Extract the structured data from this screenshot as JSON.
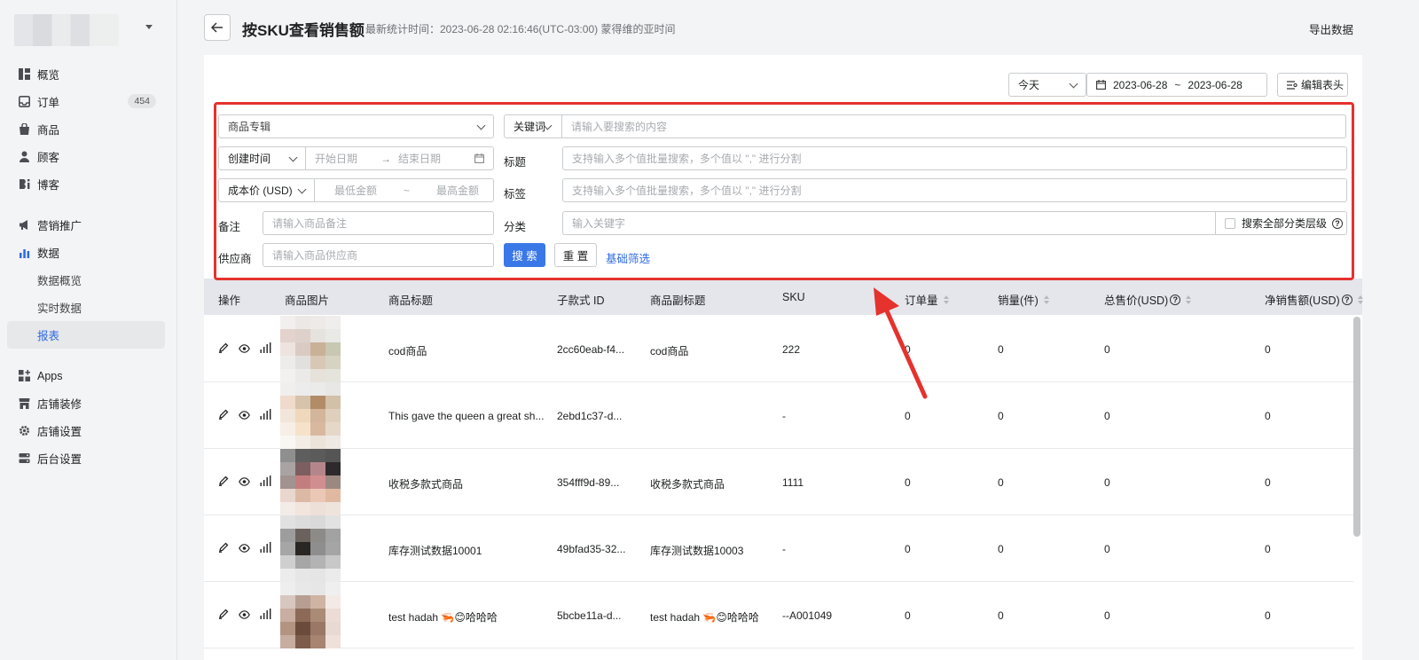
{
  "store": {
    "name": ""
  },
  "nav": [
    {
      "label": "概览",
      "icon": "overview-icon"
    },
    {
      "label": "订单",
      "icon": "orders-icon",
      "badge": "454"
    },
    {
      "label": "商品",
      "icon": "products-icon"
    },
    {
      "label": "顾客",
      "icon": "customers-icon"
    },
    {
      "label": "博客",
      "icon": "blog-icon"
    },
    {
      "label": "营销推广",
      "icon": "marketing-icon"
    },
    {
      "label": "数据",
      "icon": "analytics-icon",
      "active_color": "#2d6ae3"
    },
    {
      "label": "数据概览"
    },
    {
      "label": "实时数据"
    },
    {
      "label": "报表",
      "active": true
    },
    {
      "label": "Apps",
      "icon": "apps-icon"
    },
    {
      "label": "店铺装修",
      "icon": "storefront-icon"
    },
    {
      "label": "店铺设置",
      "icon": "settings-icon"
    },
    {
      "label": "后台设置",
      "icon": "admin-icon"
    }
  ],
  "header": {
    "title": "按SKU查看销售额",
    "stat_time": "最新统计时间：2023-06-28 02:16:46(UTC-03:00) 蒙得维的亚时间",
    "export_label": "导出数据"
  },
  "toolbar": {
    "date_preset": "今天",
    "date_start": "2023-06-28",
    "date_sep": "~",
    "date_end": "2023-06-28",
    "edit_columns_label": "编辑表头"
  },
  "filters": {
    "collection_placeholder": "商品专辑",
    "keyword_type": "关键词",
    "keyword_placeholder": "请输入要搜索的内容",
    "time_type": "创建时间",
    "start_date_placeholder": "开始日期",
    "arrow": "→",
    "end_date_placeholder": "结束日期",
    "title_label": "标题",
    "title_placeholder": "支持输入多个值批量搜索，多个值以 \",\" 进行分割",
    "price_type": "成本价 (USD)",
    "min_placeholder": "最低金额",
    "range_sep": "~",
    "max_placeholder": "最高金额",
    "tag_label": "标签",
    "tag_placeholder": "支持输入多个值批量搜索，多个值以 \",\" 进行分割",
    "note_label": "备注",
    "note_placeholder": "请输入商品备注",
    "category_label": "分类",
    "category_placeholder": "输入关键字",
    "search_all_levels": "搜索全部分类层级",
    "supplier_label": "供应商",
    "supplier_placeholder": "请输入商品供应商",
    "search_btn": "搜 索",
    "reset_btn": "重 置",
    "basic_filter": "基础筛选"
  },
  "table": {
    "columns": [
      "操作",
      "商品图片",
      "商品标题",
      "子款式 ID",
      "商品副标题",
      "SKU",
      "订单量",
      "销量(件)",
      "总售价(USD)",
      "净销售额(USD)"
    ],
    "rows": [
      {
        "title": "cod商品",
        "variant_id": "2cc60eab-f4...",
        "subtitle": "cod商品",
        "sku": "222",
        "orders": "0",
        "sales": "0",
        "total": "0",
        "net": "0",
        "thumb": [
          "#f3efee",
          "#ece8e6",
          "#eeeae8",
          "#f0eeec",
          "#e4d2cd",
          "#ded1cc",
          "#e6e2de",
          "#e9e9e6",
          "#eee3df",
          "#d9cbc3",
          "#c9b198",
          "#c8c7b2",
          "#eeeceb",
          "#e2e0de",
          "#d9c7b5",
          "#d6d3c2",
          "#f3f1f0",
          "#eceae8",
          "#e6e2da",
          "#e4e4dc"
        ]
      },
      {
        "title": "This gave the queen a great sh...",
        "variant_id": "2ebd1c37-d...",
        "subtitle": "",
        "sku": "-",
        "orders": "0",
        "sales": "0",
        "total": "0",
        "net": "0",
        "thumb": [
          "#f0efee",
          "#ececec",
          "#ebebea",
          "#e8e7e6",
          "#efdacb",
          "#d7c2ac",
          "#b28b67",
          "#d3c0a8",
          "#f2e5d9",
          "#efd8bb",
          "#d2b59a",
          "#e0cfbd",
          "#f7eee6",
          "#f6e2cb",
          "#d9b8a0",
          "#e6d8c9",
          "#faf7f3",
          "#f4ede6",
          "#ece3da",
          "#efe9e3"
        ]
      },
      {
        "title": "收税多款式商品",
        "variant_id": "354fff9d-89...",
        "subtitle": "收税多款式商品",
        "sku": "1111",
        "orders": "0",
        "sales": "0",
        "total": "0",
        "net": "0",
        "thumb": [
          "#8f8f8f",
          "#5e5e5e",
          "#5b5b5b",
          "#555555",
          "#a9a4a3",
          "#7d5e60",
          "#b4868b",
          "#2e2a2b",
          "#a29290",
          "#c47d7f",
          "#d18e91",
          "#9b8881",
          "#e9d6cc",
          "#dcb9a5",
          "#ebc7b6",
          "#e1b9a1",
          "#f3ebe6",
          "#f1e5de",
          "#ede0d8",
          "#efe4dc"
        ]
      },
      {
        "title": "库存测试数据10001",
        "variant_id": "49bfad35-32...",
        "subtitle": "库存测试数据10003",
        "sku": "-",
        "orders": "0",
        "sales": "0",
        "total": "0",
        "net": "0",
        "thumb": [
          "#e1e1e1",
          "#dcdcdc",
          "#d9d9d9",
          "#e2e2e2",
          "#9d9d9d",
          "#6b625d",
          "#8c8b87",
          "#a2a2a2",
          "#a6a6a6",
          "#2a2624",
          "#8e8e8e",
          "#a5a5a5",
          "#cfcfcf",
          "#a6a6a6",
          "#b3b3b3",
          "#c8c8c8",
          "#ececec",
          "#e6e6e6",
          "#e5e5e5",
          "#ebebeb"
        ]
      },
      {
        "title": "test hadah 🦐😊哈哈哈",
        "variant_id": "5bcbe11a-d...",
        "subtitle": "test hadah 🦐😊哈哈哈",
        "sku": "--A001049",
        "orders": "0",
        "sales": "0",
        "total": "0",
        "net": "0",
        "thumb": [
          "#eeeeee",
          "#e8e8e8",
          "#e6e6e6",
          "#efefef",
          "#d8c7c0",
          "#b79e92",
          "#cfb3a3",
          "#f3eae6",
          "#c9aea1",
          "#8c6a57",
          "#a98b76",
          "#ecdcd5",
          "#b29481",
          "#6b4b3b",
          "#9a7766",
          "#e8d9d2",
          "#c6ada0",
          "#7d5c4c",
          "#a78572",
          "#efe1da"
        ]
      }
    ]
  },
  "colors": {
    "accent": "#3b78e7",
    "highlight": "#e5322d",
    "link": "#2d6ae3"
  }
}
